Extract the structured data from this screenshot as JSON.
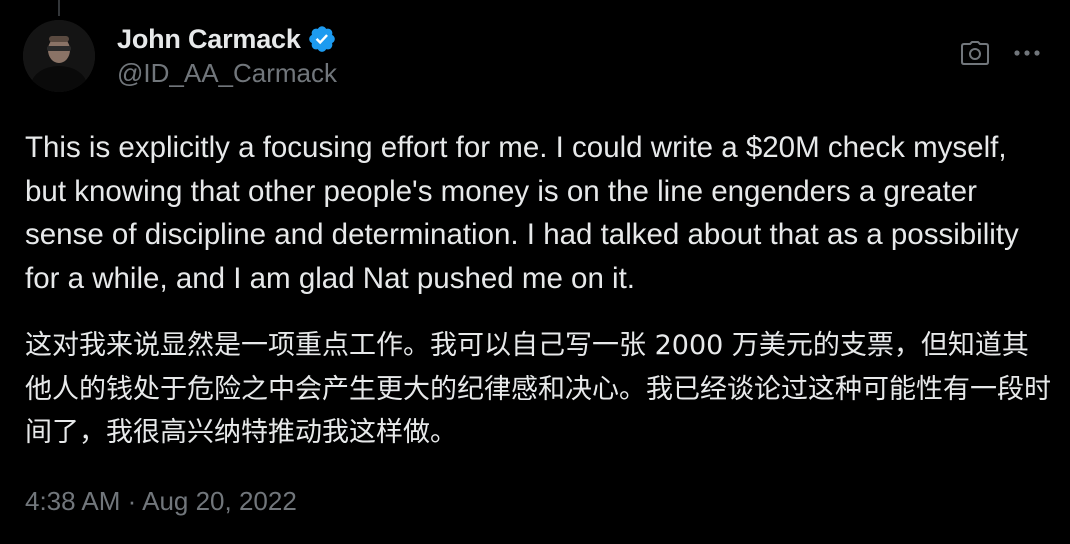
{
  "author": {
    "display_name": "John Carmack",
    "handle": "@ID_AA_Carmack",
    "verified": true,
    "avatar_icon": "profile-photo"
  },
  "actions": {
    "camera_icon": "camera-icon",
    "more_icon": "more-options-icon"
  },
  "tweet": {
    "text_en": "This is explicitly a focusing effort for me. I could write a $20M check myself, but knowing that other people's money is on the line engenders a greater sense of discipline and determination. I had talked about that as a possibility for a while, and I am glad Nat pushed me on it.",
    "text_zh": "这对我来说显然是一项重点工作。我可以自己写一张 2000 万美元的支票，但知道其他人的钱处于危险之中会产生更大的纪律感和决心。我已经谈论过这种可能性有一段时间了，我很高兴纳特推动我这样做。"
  },
  "meta": {
    "time": "4:38 AM",
    "separator": "·",
    "date": "Aug 20, 2022"
  },
  "colors": {
    "background": "#000000",
    "primary_text": "#e7e9ea",
    "secondary_text": "#71767b",
    "verified_badge": "#1d9bf0"
  }
}
